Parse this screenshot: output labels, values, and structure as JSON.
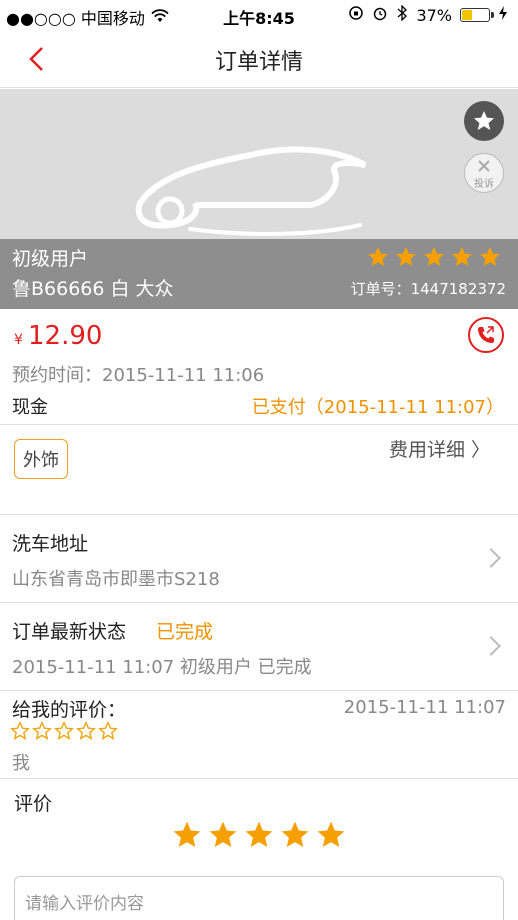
{
  "status_bar": {
    "carrier": "●●○○○ 中国移动",
    "time": "上午8:45",
    "battery": "37%",
    "battery_level": 0.37
  },
  "nav": {
    "title": "订单详情"
  },
  "banner": {
    "complain_label": "投诉",
    "user_level": "初级用户",
    "car_info": "鲁B66666 白 大众",
    "order_number": "订单号：1447182372",
    "rating_stars": 5
  },
  "payment": {
    "currency": "¥",
    "amount": "12.90",
    "reservation": "预约时间：2015-11-11 11:06",
    "method": "现金",
    "paid_status": "已支付（2015-11-11 11:07）"
  },
  "service": {
    "tag": "外饰",
    "fee_detail": "费用详细 〉"
  },
  "address": {
    "label": "洗车地址",
    "value": "山东省青岛市即墨市S218"
  },
  "status": {
    "label": "订单最新状态",
    "value": "已完成",
    "detail": "2015-11-11 11:07 初级用户 已完成"
  },
  "my_review": {
    "label": "给我的评价：",
    "time": "2015-11-11 11:07",
    "empty_stars": 5,
    "reviewer": "我"
  },
  "rate": {
    "label": "评价",
    "stars": 5,
    "placeholder": "请输入评价内容"
  },
  "colors": {
    "accent_red": "#e02020",
    "orange": "#f09200",
    "star": "#f5a000"
  }
}
